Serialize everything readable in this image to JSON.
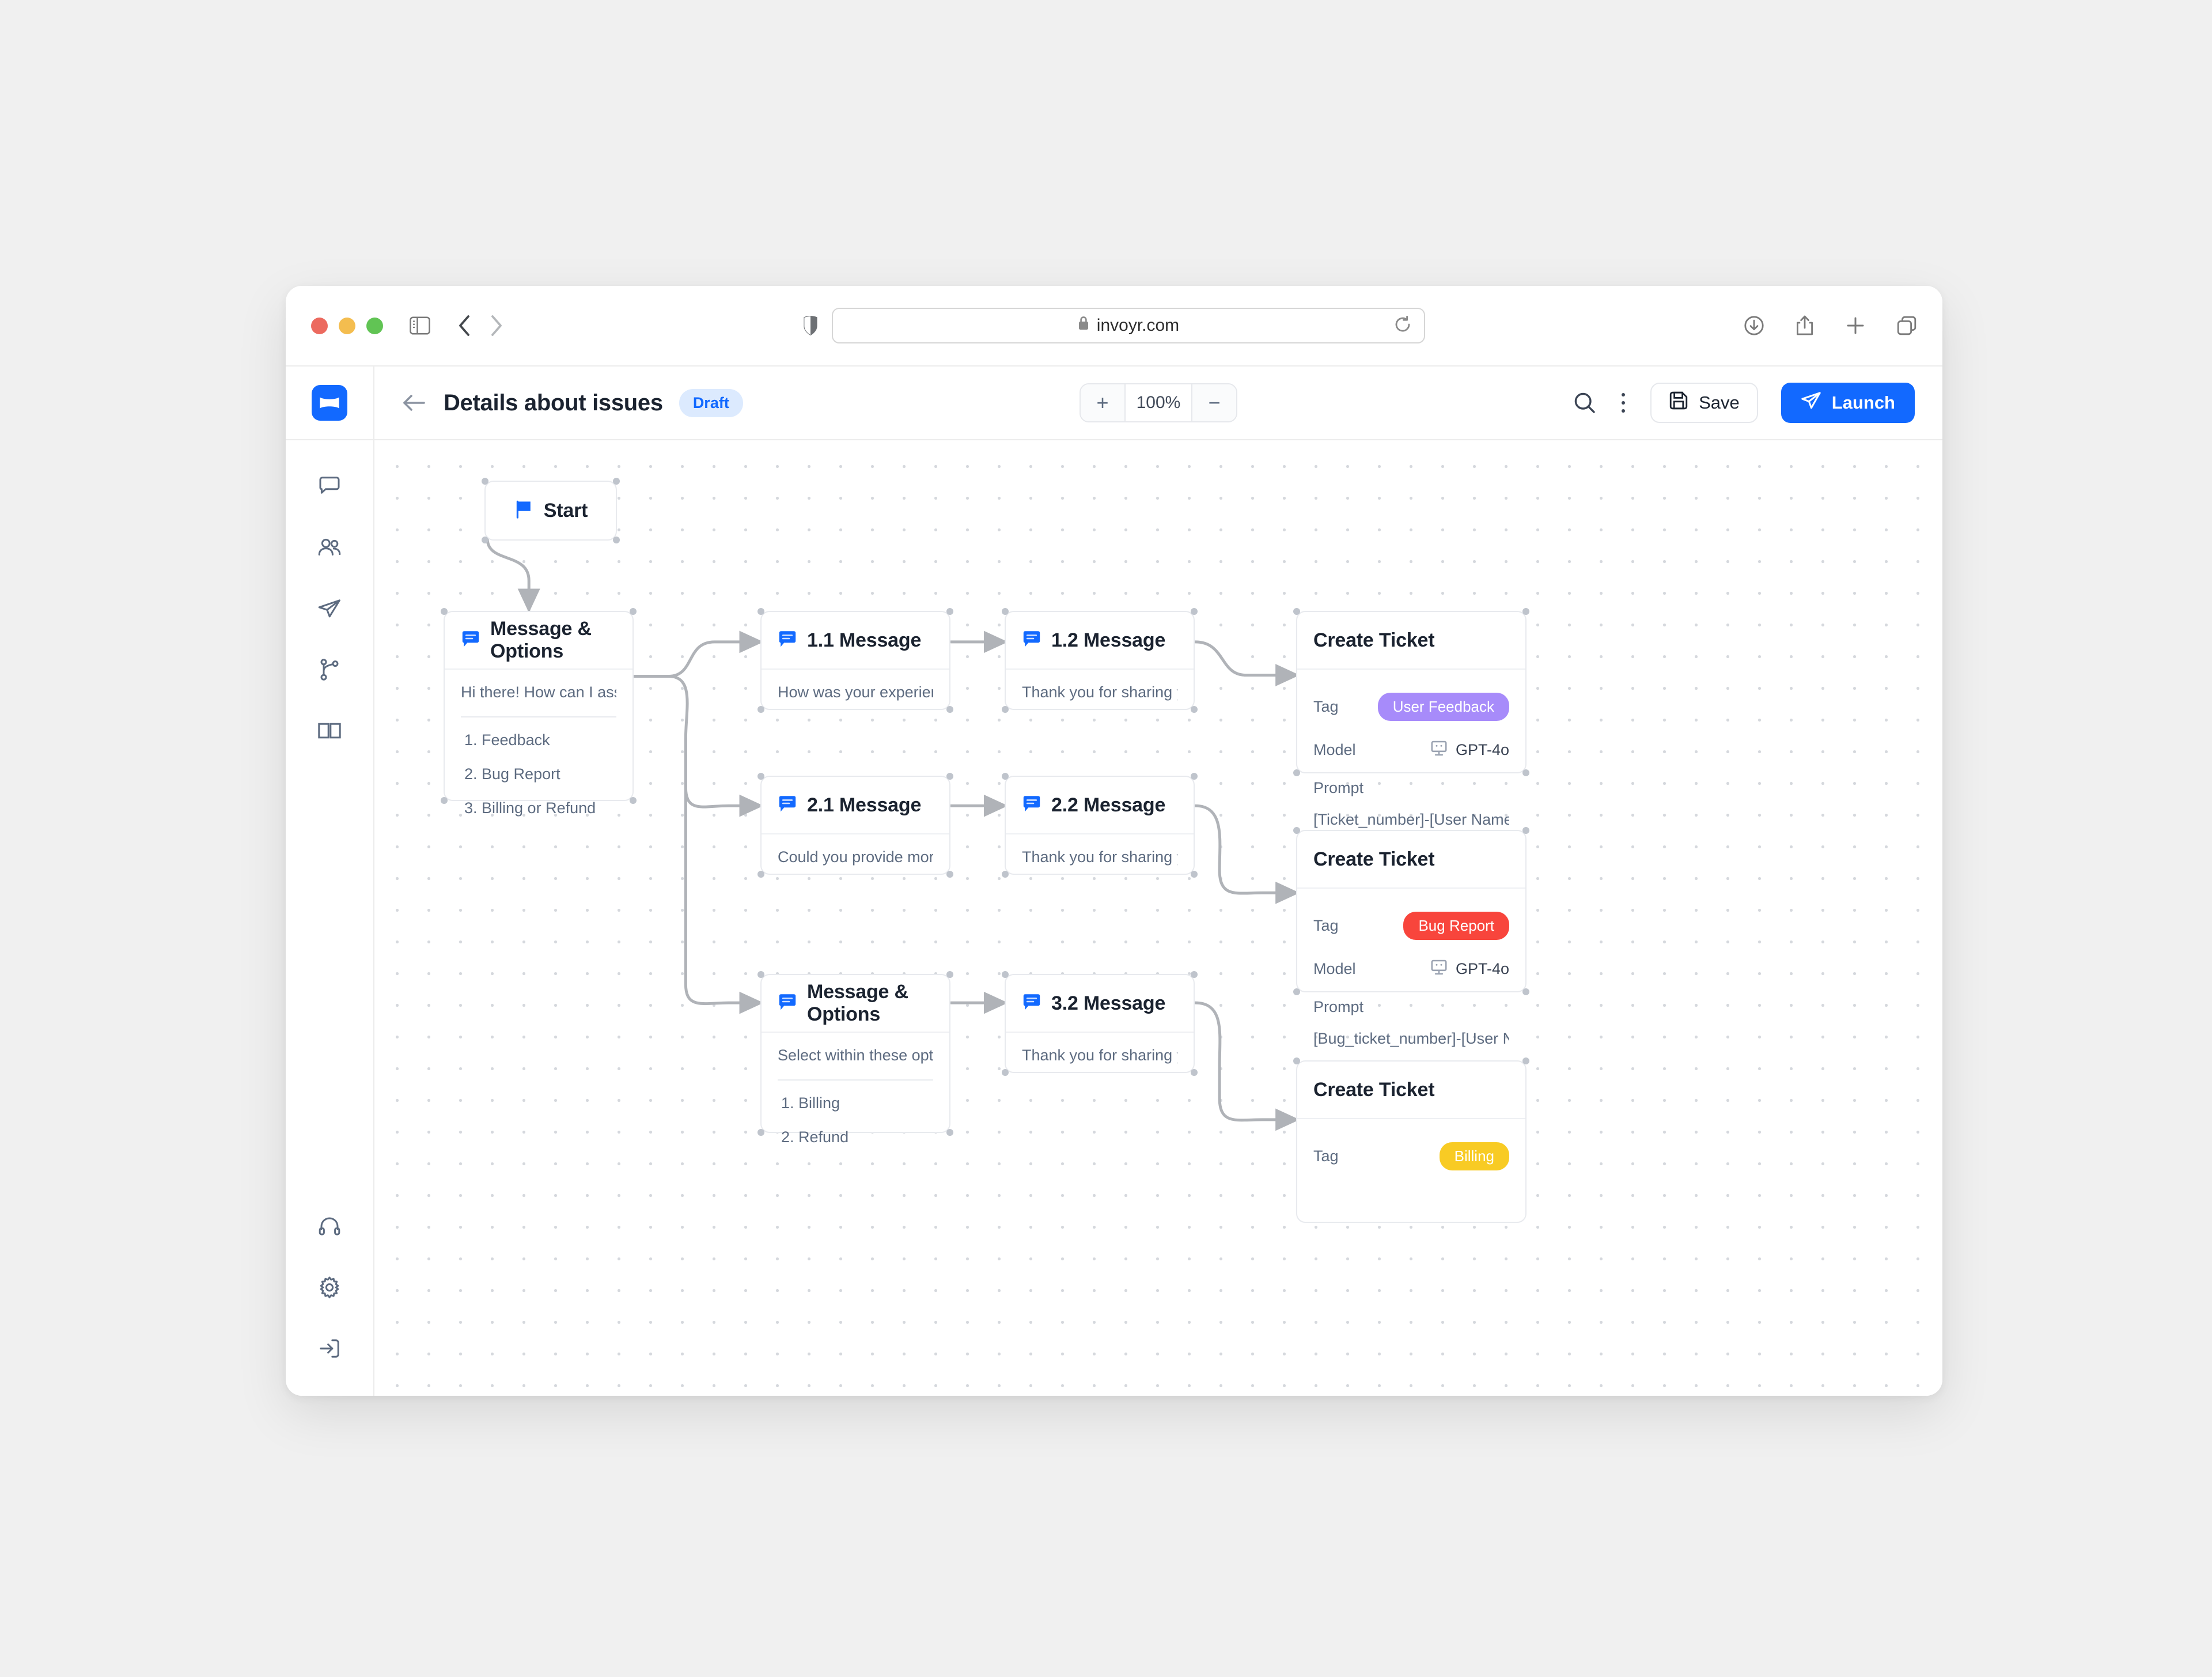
{
  "browser": {
    "url": "invoyr.com",
    "lock_icon": "lock-icon",
    "reload_icon": "reload-icon",
    "sidebar_icon": "sidebar-toggle-icon",
    "back_icon": "chevron-left-icon",
    "forward_icon": "chevron-right-icon",
    "shield_icon": "shield-icon",
    "download_icon": "download-icon",
    "share_icon": "share-icon",
    "newtab_icon": "plus-icon",
    "tabs_icon": "tabs-overview-icon"
  },
  "rail": {
    "logo_icon": "invoyr-logo-icon",
    "items": [
      {
        "icon": "chat-bubble-icon",
        "name": "sidebar-item-chats"
      },
      {
        "icon": "users-icon",
        "name": "sidebar-item-contacts"
      },
      {
        "icon": "paper-plane-icon",
        "name": "sidebar-item-broadcast"
      },
      {
        "icon": "flow-branch-icon",
        "name": "sidebar-item-flows"
      },
      {
        "icon": "book-icon",
        "name": "sidebar-item-knowledge"
      }
    ],
    "bottom_items": [
      {
        "icon": "headphones-icon",
        "name": "sidebar-item-support"
      },
      {
        "icon": "gear-icon",
        "name": "sidebar-item-settings"
      },
      {
        "icon": "logout-icon",
        "name": "sidebar-item-logout"
      }
    ]
  },
  "header": {
    "back_label": "back-arrow-icon",
    "title": "Details about issues",
    "status_badge": "Draft",
    "zoom": {
      "increase": "+",
      "value": "100%",
      "decrease": "−"
    },
    "search_icon": "search-icon",
    "more_icon": "more-vertical-icon",
    "save_label": "Save",
    "save_icon": "save-disk-icon",
    "launch_label": "Launch",
    "launch_icon": "paper-plane-icon"
  },
  "flow": {
    "start": {
      "title": "Start",
      "icon": "flag-icon"
    },
    "message_options_1": {
      "title": "Message & Options",
      "icon": "message-icon",
      "text": "Hi there! How can I assist you toda...",
      "options": [
        "1. Feedback",
        "2. Bug Report",
        "3. Billing or Refund"
      ]
    },
    "node_1_1": {
      "title": "1.1 Message",
      "icon": "message-icon",
      "text": "How was your experience with us..."
    },
    "node_2_1": {
      "title": "2.1 Message",
      "icon": "message-icon",
      "text": "Could you provide more details re..."
    },
    "message_options_2": {
      "title": "Message & Options",
      "icon": "message-icon",
      "text": "Select within these options:",
      "options": [
        "1. Billing",
        "2. Refund"
      ]
    },
    "node_1_2": {
      "title": "1.2 Message",
      "icon": "message-icon",
      "text": "Thank you for sharing your feedba..."
    },
    "node_2_2": {
      "title": "2.2 Message",
      "icon": "message-icon",
      "text": "Thank you for sharing your Bug Re..."
    },
    "node_3_2": {
      "title": "3.2 Message",
      "icon": "message-icon",
      "text": "Thank you for sharing your feedba..."
    },
    "ticket_1": {
      "title": "Create Ticket",
      "tag_label": "Tag",
      "tag_value": "User Feedback",
      "tag_color": "#a78bfa",
      "model_label": "Model",
      "model_value": "GPT-4o",
      "model_icon": "monitor-icon",
      "prompt_label": "Prompt",
      "prompt_value": "[Ticket_number]-[User Name] has..."
    },
    "ticket_2": {
      "title": "Create Ticket",
      "tag_label": "Tag",
      "tag_value": "Bug Report",
      "tag_color": "#f8453c",
      "model_label": "Model",
      "model_value": "GPT-4o",
      "model_icon": "monitor-icon",
      "prompt_label": "Prompt",
      "prompt_value": "[Bug_ticket_number]-[User Name..."
    },
    "ticket_3": {
      "title": "Create Ticket",
      "tag_label": "Tag",
      "tag_value": "Billing",
      "tag_color": "#f8cb24"
    }
  },
  "colors": {
    "accent": "#1269ff",
    "draft_bg": "#dceafe",
    "edge": "#b0b3b8"
  }
}
